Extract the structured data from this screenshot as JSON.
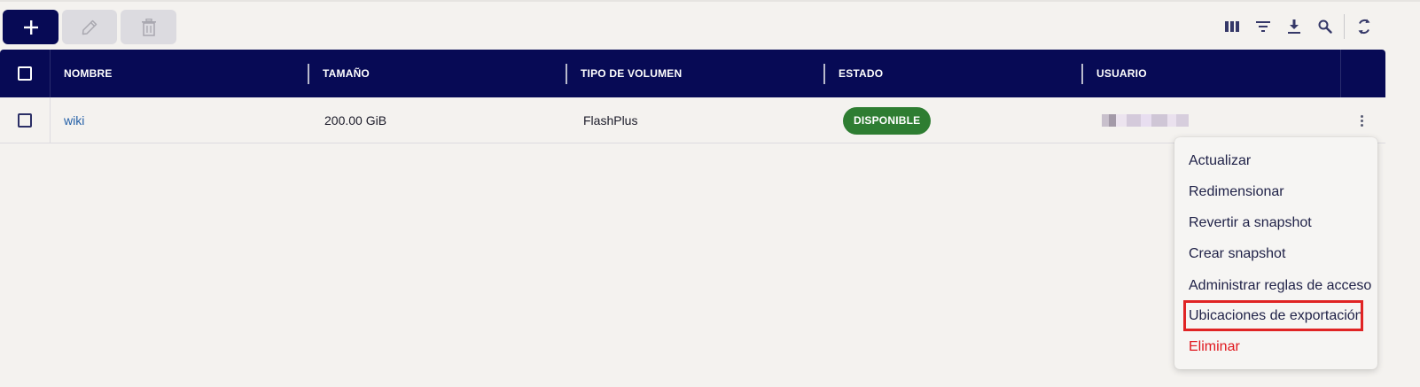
{
  "toolbar": {
    "add_icon": "plus-icon",
    "edit_icon": "pencil-icon",
    "delete_icon": "trash-icon",
    "right_icons": [
      "columns-icon",
      "filter-icon",
      "download-icon",
      "search-icon",
      "refresh-icon"
    ]
  },
  "table": {
    "columns": [
      "NOMBRE",
      "TAMAÑO",
      "TIPO DE VOLUMEN",
      "ESTADO",
      "USUARIO"
    ],
    "rows": [
      {
        "nombre": "wiki",
        "tamano": "200.00 GiB",
        "tipo": "FlashPlus",
        "estado": "DISPONIBLE",
        "usuario": "redacted (pixelated)"
      }
    ]
  },
  "menu": {
    "items": [
      "Actualizar",
      "Redimensionar",
      "Revertir a snapshot",
      "Crear snapshot",
      "Administrar reglas de acceso",
      "Ubicaciones de exportación",
      "Eliminar"
    ],
    "highlighted_index": 5
  },
  "colors": {
    "header_bg": "#070a55",
    "badge_green": "#2e7d32",
    "link_blue": "#2561a8",
    "danger_red": "#e0161c",
    "highlight_red": "#e02424"
  }
}
